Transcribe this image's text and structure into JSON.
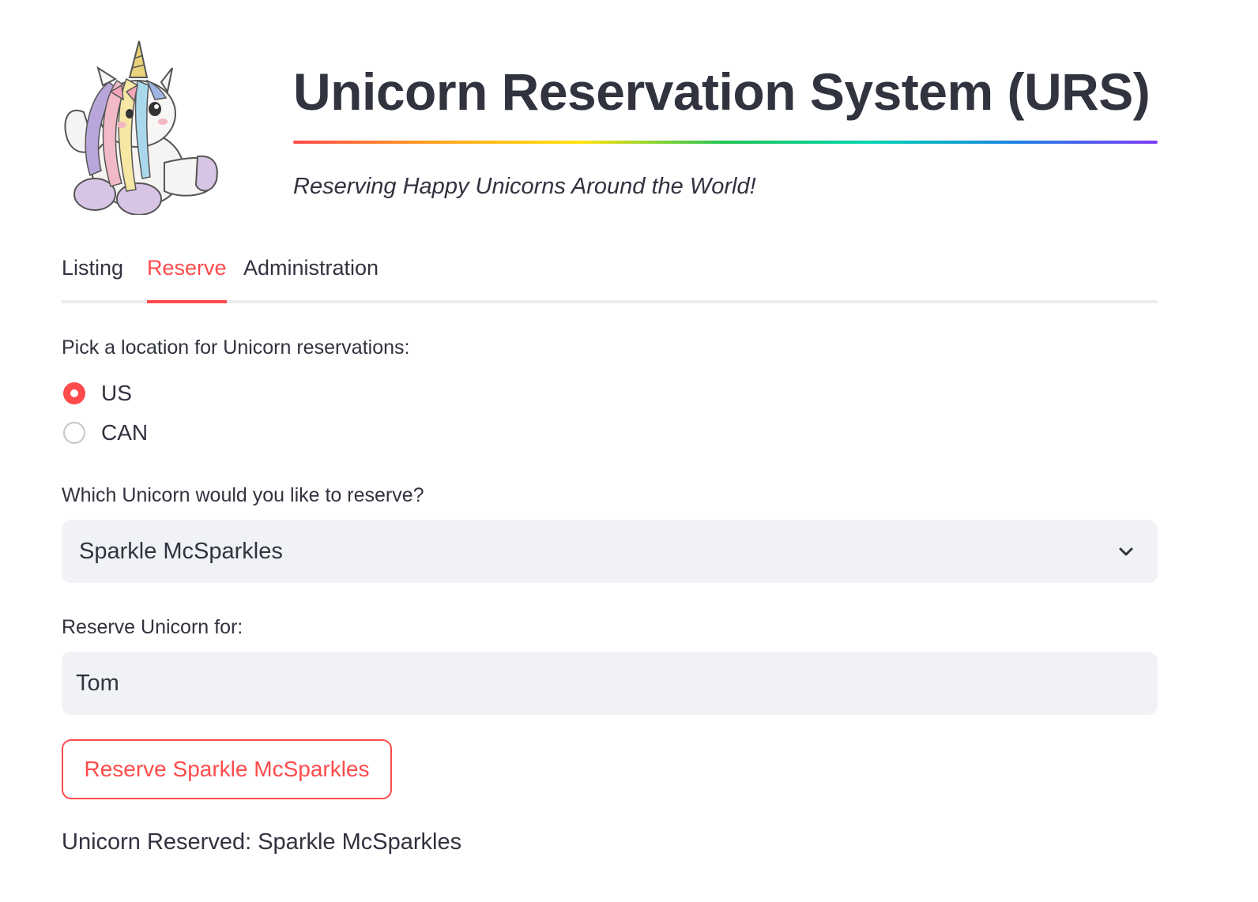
{
  "header": {
    "logo_icon": "unicorn-logo-icon",
    "title": "Unicorn Reservation System (URS)",
    "subtitle": "Reserving Happy Unicorns Around the World!"
  },
  "tabs": [
    {
      "label": "Listing",
      "active": false
    },
    {
      "label": "Reserve",
      "active": true
    },
    {
      "label": "Administration",
      "active": false
    }
  ],
  "location": {
    "label": "Pick a location for Unicorn reservations:",
    "options": [
      "US",
      "CAN"
    ],
    "selected": "US"
  },
  "unicorn_select": {
    "label": "Which Unicorn would you like to reserve?",
    "value": "Sparkle McSparkles",
    "icon": "chevron-down-icon"
  },
  "reserve_for": {
    "label": "Reserve Unicorn for:",
    "value": "Tom"
  },
  "reserve_button": {
    "label": "Reserve Sparkle McSparkles"
  },
  "result_text": "Unicorn Reserved: Sparkle McSparkles",
  "colors": {
    "accent": "#ff4b4b",
    "text": "#31333f",
    "input_bg": "#f0f2f6"
  }
}
